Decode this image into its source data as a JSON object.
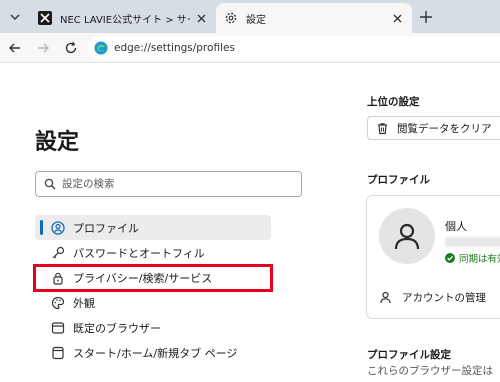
{
  "browser": {
    "tabs": [
      {
        "title": "NEC LAVIE公式サイト > サービス&サ",
        "active": false,
        "favicon": "nec-favicon-icon"
      },
      {
        "title": "設定",
        "active": true,
        "favicon": "gear-icon"
      }
    ],
    "address": "edge://settings/profiles"
  },
  "sidebar": {
    "title": "設定",
    "search_placeholder": "設定の検索",
    "items": [
      {
        "label": "プロファイル",
        "icon": "profile-icon",
        "selected": true
      },
      {
        "label": "パスワードとオートフィル",
        "icon": "key-icon",
        "selected": false
      },
      {
        "label": "プライバシー/検索/サービス",
        "icon": "lock-icon",
        "selected": false
      },
      {
        "label": "外観",
        "icon": "palette-icon",
        "selected": false
      },
      {
        "label": "既定のブラウザー",
        "icon": "browser-icon",
        "selected": false
      },
      {
        "label": "スタート/ホーム/新規タブ ページ",
        "icon": "home-page-icon",
        "selected": false
      }
    ]
  },
  "main": {
    "top_settings_title": "上位の設定",
    "clear_data_label": "閲覧データをクリア",
    "profile_section_title": "プロファイル",
    "profile": {
      "name": "個人",
      "sync_status": "同期は有効"
    },
    "manage_account_label": "アカウントの管理",
    "profile_settings_title": "プロファイル設定",
    "profile_settings_desc": "これらのブラウザー設定は"
  },
  "colors": {
    "highlight": "#e8001c",
    "accent": "#0f6cbd",
    "sync_green": "#1b7c1b"
  }
}
